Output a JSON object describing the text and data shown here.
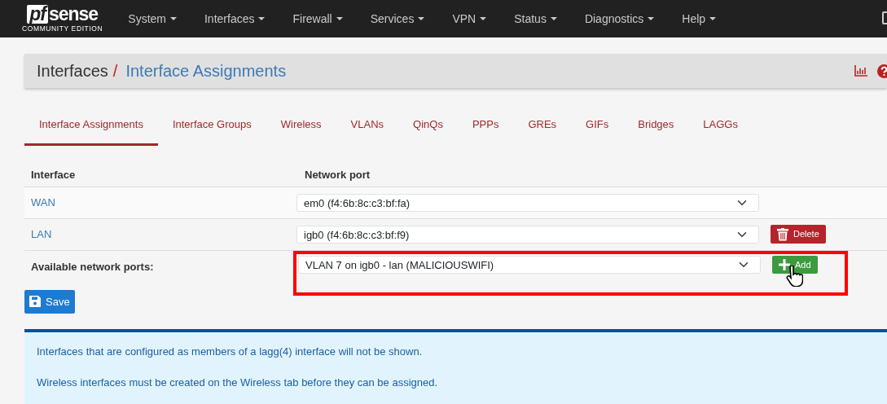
{
  "navbar": {
    "logo": {
      "mark": "pf",
      "word": "sense",
      "edition": "COMMUNITY EDITION"
    },
    "menus": [
      {
        "label": "System"
      },
      {
        "label": "Interfaces"
      },
      {
        "label": "Firewall"
      },
      {
        "label": "Services"
      },
      {
        "label": "VPN"
      },
      {
        "label": "Status"
      },
      {
        "label": "Diagnostics"
      },
      {
        "label": "Help"
      }
    ]
  },
  "breadcrumb": {
    "parent": "Interfaces",
    "separator": "/",
    "current": "Interface Assignments"
  },
  "tabs": [
    {
      "label": "Interface Assignments",
      "selected": true
    },
    {
      "label": "Interface Groups",
      "selected": false
    },
    {
      "label": "Wireless",
      "selected": false
    },
    {
      "label": "VLANs",
      "selected": false
    },
    {
      "label": "QinQs",
      "selected": false
    },
    {
      "label": "PPPs",
      "selected": false
    },
    {
      "label": "GREs",
      "selected": false
    },
    {
      "label": "GIFs",
      "selected": false
    },
    {
      "label": "Bridges",
      "selected": false
    },
    {
      "label": "LAGGs",
      "selected": false
    }
  ],
  "table": {
    "columns": [
      "Interface",
      "Network port"
    ],
    "rows": [
      {
        "interface": "WAN",
        "port": "em0 (f4:6b:8c:c3:bf:fa)"
      },
      {
        "interface": "LAN",
        "port": "igb0 (f4:6b:8c:c3:bf:f9)",
        "action": "Delete"
      }
    ]
  },
  "available": {
    "label": "Available network ports:",
    "port": "VLAN 7 on igb0 - lan (MALICIOUSWIFI)",
    "action": "Add",
    "highlighted": true
  },
  "save_button": "Save",
  "info": [
    "Interfaces that are configured as members of a lagg(4) interface will not be shown.",
    "Wireless interfaces must be created on the Wireless tab before they can be assigned."
  ]
}
